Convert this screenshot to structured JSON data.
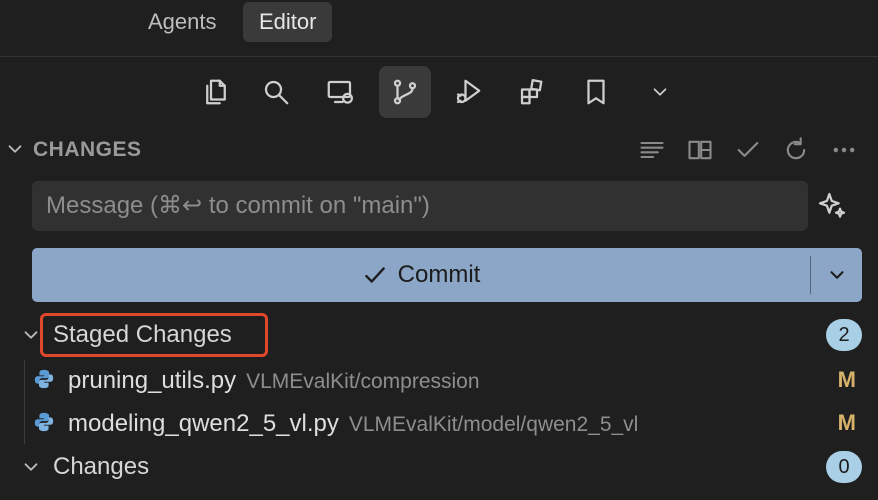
{
  "top_tabs": {
    "agents": "Agents",
    "editor": "Editor"
  },
  "activity_bar": {
    "items": [
      {
        "icon": "files-icon"
      },
      {
        "icon": "search-icon"
      },
      {
        "icon": "remote-explorer-icon"
      },
      {
        "icon": "source-control-icon",
        "active": true
      },
      {
        "icon": "run-debug-icon"
      },
      {
        "icon": "extensions-icon"
      },
      {
        "icon": "bookmark-icon"
      },
      {
        "icon": "chevron-down-icon"
      }
    ]
  },
  "changes_section": {
    "title": "CHANGES",
    "actions": [
      "view-as-tree-icon",
      "split-view-icon",
      "check-icon",
      "refresh-icon",
      "more-icon"
    ]
  },
  "commit": {
    "message_placeholder": "Message (⌘↩ to commit on \"main\")",
    "message_value": "",
    "button_label": "Commit",
    "button_color": "#8ba6c6"
  },
  "staged_changes": {
    "label": "Staged Changes",
    "count": "2",
    "files": [
      {
        "name": "pruning_utils.py",
        "path": "VLMEvalKit/compression",
        "status": "M"
      },
      {
        "name": "modeling_qwen2_5_vl.py",
        "path": "VLMEvalKit/model/qwen2_5_vl",
        "status": "M"
      }
    ]
  },
  "changes": {
    "label": "Changes",
    "count": "0"
  },
  "colors": {
    "highlight": "#e0482c",
    "badge": "#a9cfe6",
    "modified": "#d6b26a"
  }
}
